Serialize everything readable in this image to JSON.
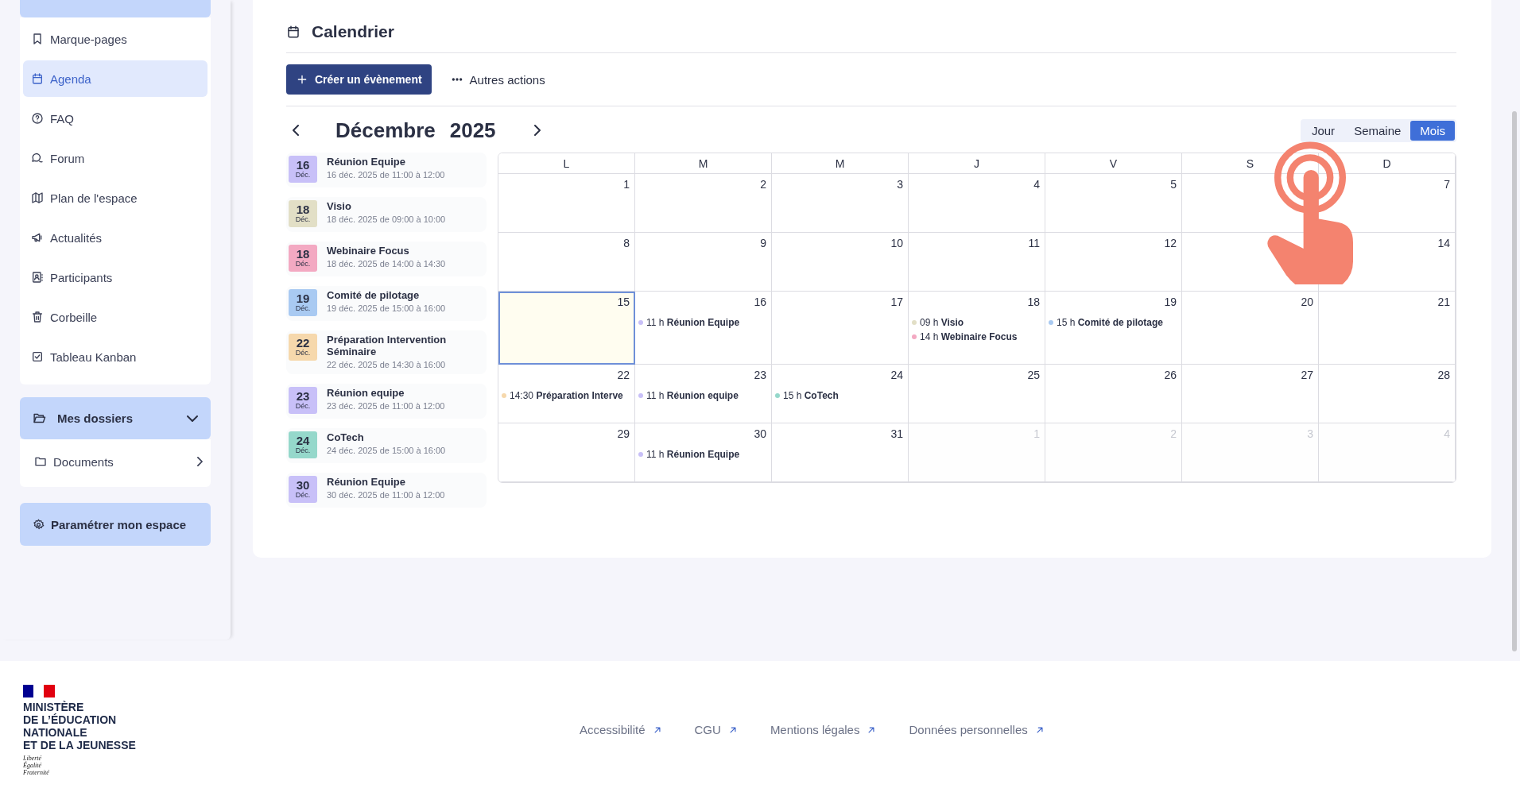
{
  "sidebar": {
    "items": [
      {
        "label": "Marque-pages",
        "selected": false
      },
      {
        "label": "Agenda",
        "selected": true
      },
      {
        "label": "FAQ",
        "selected": false
      },
      {
        "label": "Forum",
        "selected": false
      },
      {
        "label": "Plan de l'espace",
        "selected": false
      },
      {
        "label": "Actualités",
        "selected": false
      },
      {
        "label": "Participants",
        "selected": false
      },
      {
        "label": "Corbeille",
        "selected": false
      },
      {
        "label": "Tableau Kanban",
        "selected": false
      }
    ],
    "folders": {
      "label": "Mes dossiers",
      "expanded": true,
      "items": [
        {
          "label": "Documents"
        }
      ]
    },
    "settings_button": "Paramétrer mon espace"
  },
  "page": {
    "title": "Calendrier",
    "create_button": "Créer un évènement",
    "more_actions": "Autres actions"
  },
  "events": [
    {
      "day": "16",
      "month": "Déc.",
      "title": "Réunion Equipe",
      "when": "16 déc. 2025 de 11:00 à 12:00",
      "color": "#c8c0f8"
    },
    {
      "day": "18",
      "month": "Déc.",
      "title": "Visio",
      "when": "18 déc. 2025 de 09:00 à 10:00",
      "color": "#e2dfc6"
    },
    {
      "day": "18",
      "month": "Déc.",
      "title": "Webinaire Focus",
      "when": "18 déc. 2025 de 14:00 à 14:30",
      "color": "#f3a9c2"
    },
    {
      "day": "19",
      "month": "Déc.",
      "title": "Comité de pilotage",
      "when": "19 déc. 2025 de 15:00 à 16:00",
      "color": "#a9caf2"
    },
    {
      "day": "22",
      "month": "Déc.",
      "title": "Préparation Intervention Séminaire",
      "when": "22 déc. 2025 de 14:30 à 16:00",
      "color": "#f6d8ac"
    },
    {
      "day": "23",
      "month": "Déc.",
      "title": "Réunion equipe",
      "when": "23 déc. 2025 de 11:00 à 12:00",
      "color": "#c8c0f8"
    },
    {
      "day": "24",
      "month": "Déc.",
      "title": "CoTech",
      "when": "24 déc. 2025 de 15:00 à 16:00",
      "color": "#95d8cb"
    },
    {
      "day": "30",
      "month": "Déc.",
      "title": "Réunion Equipe",
      "when": "30 déc. 2025 de 11:00 à 12:00",
      "color": "#c8c0f8"
    }
  ],
  "calendar": {
    "month": "Décembre",
    "year": "2025",
    "views": [
      {
        "label": "Jour",
        "selected": false
      },
      {
        "label": "Semaine",
        "selected": false
      },
      {
        "label": "Mois",
        "selected": true
      }
    ],
    "weekdays": [
      "L",
      "M",
      "M",
      "J",
      "V",
      "S",
      "D"
    ],
    "weeks": [
      [
        {
          "day": "1",
          "muted": false,
          "today": false
        },
        {
          "day": "2",
          "muted": false,
          "today": false
        },
        {
          "day": "3",
          "muted": false,
          "today": false
        },
        {
          "day": "4",
          "muted": false,
          "today": false
        },
        {
          "day": "5",
          "muted": false,
          "today": false
        },
        {
          "today": false
        },
        {
          "day": "7",
          "muted": false,
          "today": false
        }
      ],
      [
        {
          "day": "8",
          "muted": false,
          "today": false
        },
        {
          "day": "9",
          "muted": false,
          "today": false
        },
        {
          "day": "10",
          "muted": false,
          "today": false
        },
        {
          "day": "11",
          "muted": false,
          "today": false
        },
        {
          "day": "12",
          "muted": false,
          "today": false
        },
        {
          "today": false
        },
        {
          "day": "14",
          "muted": false,
          "today": false
        }
      ],
      [
        {
          "day": "15",
          "muted": false,
          "today": true
        },
        {
          "day": "16",
          "muted": false,
          "today": false,
          "events": [
            {
              "time": "11 h",
              "title": "Réunion Equipe",
              "color": "#c8c0f8"
            }
          ]
        },
        {
          "day": "17",
          "muted": false,
          "today": false
        },
        {
          "day": "18",
          "muted": false,
          "today": false,
          "events": [
            {
              "time": "09 h",
              "title": "Visio",
              "color": "#e2dfc6"
            },
            {
              "time": "14 h",
              "title": "Webinaire Focus",
              "color": "#f3a9c2"
            }
          ]
        },
        {
          "day": "19",
          "muted": false,
          "today": false,
          "events": [
            {
              "time": "15 h",
              "title": "Comité de pilotage",
              "color": "#a9caf2"
            }
          ]
        },
        {
          "day": "20",
          "muted": false,
          "today": false
        },
        {
          "day": "21",
          "muted": false,
          "today": false
        }
      ],
      [
        {
          "day": "22",
          "muted": false,
          "today": false,
          "events": [
            {
              "time": "14:30",
              "title": "Préparation Interve",
              "color": "#f6d8ac"
            }
          ]
        },
        {
          "day": "23",
          "muted": false,
          "today": false,
          "events": [
            {
              "time": "11 h",
              "title": "Réunion equipe",
              "color": "#c8c0f8"
            }
          ]
        },
        {
          "day": "24",
          "muted": false,
          "today": false,
          "events": [
            {
              "time": "15 h",
              "title": "CoTech",
              "color": "#95d8cb"
            }
          ]
        },
        {
          "day": "25",
          "muted": false,
          "today": false
        },
        {
          "day": "26",
          "muted": false,
          "today": false
        },
        {
          "day": "27",
          "muted": false,
          "today": false
        },
        {
          "day": "28",
          "muted": false,
          "today": false
        }
      ],
      [
        {
          "day": "29",
          "muted": false,
          "today": false
        },
        {
          "day": "30",
          "muted": false,
          "today": false,
          "events": [
            {
              "time": "11 h",
              "title": "Réunion Equipe",
              "color": "#c8c0f8"
            }
          ]
        },
        {
          "day": "31",
          "muted": false,
          "today": false
        },
        {
          "day": "1",
          "muted": true,
          "today": false
        },
        {
          "day": "2",
          "muted": true,
          "today": false
        },
        {
          "day": "3",
          "muted": true,
          "today": false
        },
        {
          "day": "4",
          "muted": true,
          "today": false
        }
      ]
    ]
  },
  "footer": {
    "logo_lines": [
      "MINISTÈRE",
      "DE L’ÉDUCATION",
      "NATIONALE",
      "ET DE LA JEUNESSE"
    ],
    "motto": [
      "Liberté",
      "Égalité",
      "Fraternité"
    ],
    "links": [
      "Accessibilité",
      "CGU",
      "Mentions légales",
      "Données personnelles"
    ]
  }
}
